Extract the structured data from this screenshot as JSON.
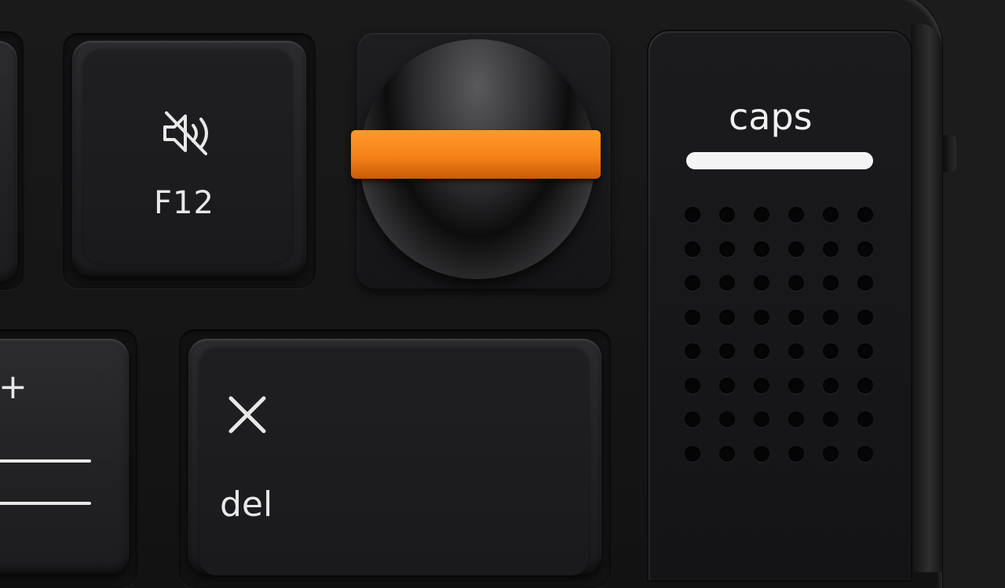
{
  "keys": {
    "f12": {
      "label": "F12",
      "icon": "mute-speaker-icon"
    },
    "caps": {
      "label": "caps"
    },
    "del": {
      "label": "del",
      "icon": "x-icon"
    },
    "plus_key": {
      "label": "+"
    }
  },
  "colors": {
    "dial_accent": "#f58218",
    "legend": "#e8e8e8",
    "body": "#151515"
  },
  "grille": {
    "rows": 8,
    "cols": 6
  }
}
